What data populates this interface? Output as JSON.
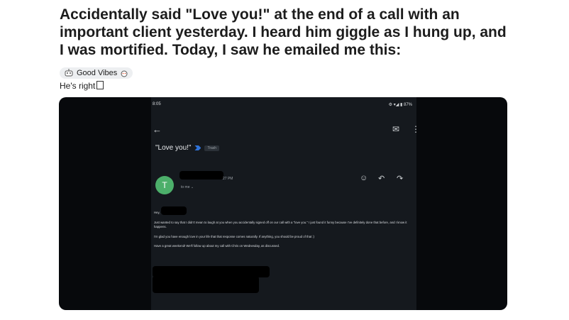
{
  "post": {
    "title": "Accidentally said \"Love you!\" at the end of a call with an important client yesterday. I heard him giggle as I hung up, and I was mortified. Today, I saw he emailed me this:",
    "flair": "Good Vibes",
    "body": "He's right"
  },
  "phone": {
    "status_time": "8:05",
    "status_right": "87%",
    "subject": "\"Love you!\"",
    "label_chip": "Trash",
    "sender_initial": "T",
    "timestamp": "27 PM",
    "recipient": "to me",
    "greeting": "Hey,",
    "para1": "Just wanted to say that I didn't mean to laugh at you when you accidentally signed off on our call with a \"love you.\" I just found it funny because I've definitely done that before, and I know it happens.",
    "para2": "I'm glad you have enough love in your life that that response comes naturally. If anything, you should be proud of that :)",
    "para3": "Have a great weekend! We'll follow up about my call with Chris on Wednesday, as discussed."
  },
  "colors": {
    "accent": "#2f73d9",
    "avatar": "#4caf6a",
    "media_bg": "#07090c",
    "phone_bg": "#15191e"
  },
  "icons": [
    "upvote-icon",
    "arrow-left-icon",
    "mail-icon",
    "more-vert-icon",
    "emoji-icon",
    "reply-icon",
    "forward-icon",
    "chevron-down-icon"
  ]
}
